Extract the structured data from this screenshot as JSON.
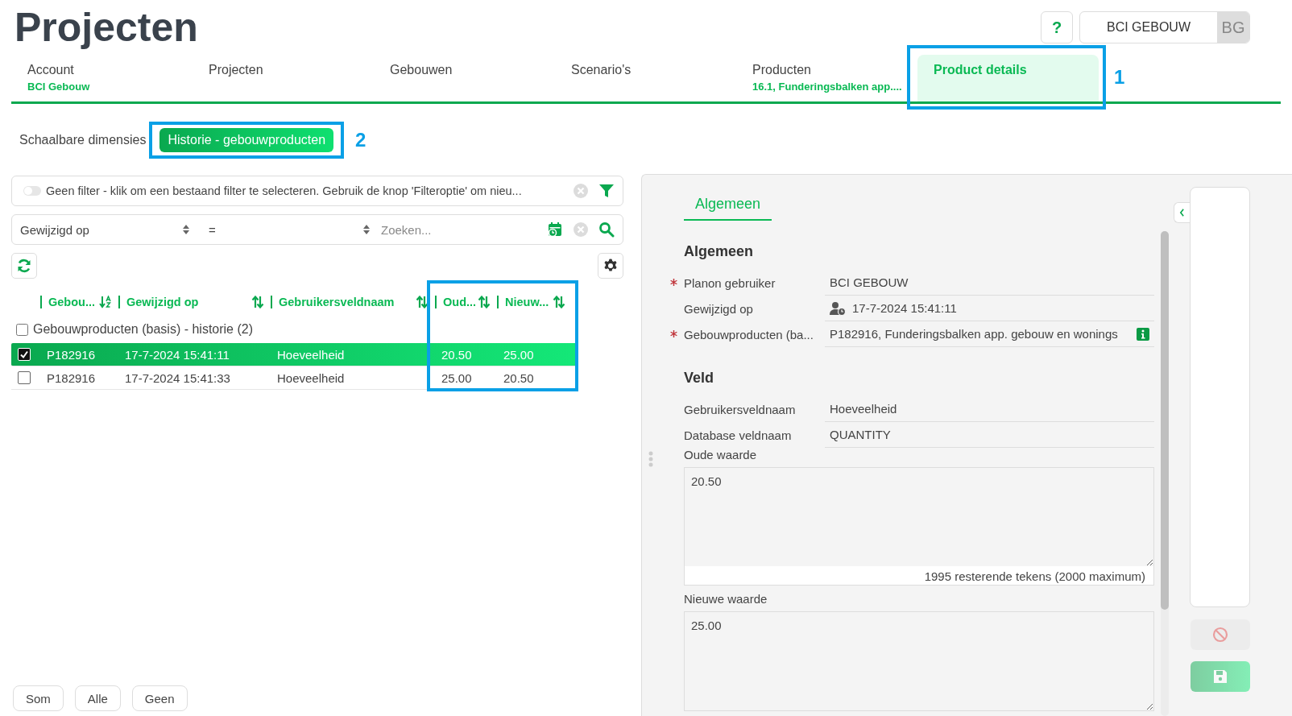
{
  "page_title": "Projecten",
  "header": {
    "help_label": "?",
    "user_name": "BCI GEBOUW",
    "user_initials": "BG"
  },
  "tabs": [
    {
      "label": "Account",
      "sublabel": "BCI Gebouw",
      "selected": false
    },
    {
      "label": "Projecten",
      "selected": false
    },
    {
      "label": "Gebouwen",
      "selected": false
    },
    {
      "label": "Scenario's",
      "selected": false
    },
    {
      "label": "Producten",
      "sublabel": "16.1, Funderingsbalken app....",
      "selected": false
    },
    {
      "label": "Product details",
      "selected": true,
      "callout": "1"
    }
  ],
  "subtabs": [
    {
      "label": "Schaalbare dimensies",
      "selected": false
    },
    {
      "label": "Historie - gebouwproducten",
      "selected": true,
      "callout": "2"
    }
  ],
  "filter": {
    "on": false,
    "text": "Geen filter - klik om een bestaand filter te selecteren. Gebruik de knop 'Filteroptie' om nieu..."
  },
  "search": {
    "field": "Gewijzigd op",
    "operator": "=",
    "placeholder": "Zoeken..."
  },
  "table": {
    "columns": [
      {
        "label": "Gebou...",
        "sorted": true,
        "highlighted": false
      },
      {
        "label": "Gewijzigd op",
        "sorted": false,
        "highlighted": false
      },
      {
        "label": "Gebruikersveldnaam",
        "sorted": false,
        "highlighted": false
      },
      {
        "label": "Oud...",
        "sorted": false,
        "highlighted": true
      },
      {
        "label": "Nieuw...",
        "sorted": false,
        "highlighted": true
      }
    ],
    "group": {
      "label": "Gebouwproducten (basis) - historie (2)",
      "checked": false
    },
    "rows": [
      {
        "checked": true,
        "selected": true,
        "cells": [
          "P182916",
          "17-7-2024 15:41:11",
          "Hoeveelheid",
          "20.50",
          "25.00"
        ]
      },
      {
        "checked": false,
        "selected": false,
        "cells": [
          "P182916",
          "17-7-2024 15:41:33",
          "Hoeveelheid",
          "25.00",
          "20.50"
        ]
      }
    ]
  },
  "footer_buttons": [
    "Som",
    "Alle",
    "Geen"
  ],
  "detail": {
    "tabs": [
      {
        "label": "Algemeen",
        "selected": true
      }
    ],
    "sections": [
      {
        "title": "Algemeen",
        "fields": [
          {
            "kind": "text",
            "label": "Planon gebruiker",
            "value": "BCI GEBOUW",
            "required": true
          },
          {
            "kind": "user-time",
            "label": "Gewijzigd op",
            "value": "17-7-2024 15:41:11",
            "required": false
          },
          {
            "kind": "lookup",
            "label": "Gebouwproducten (ba...",
            "value": "P182916, Funderingsbalken app. gebouw en wonings",
            "required": true
          }
        ]
      },
      {
        "title": "Veld",
        "fields": [
          {
            "kind": "text",
            "label": "Gebruikersveldnaam",
            "value": "Hoeveelheid",
            "required": false
          },
          {
            "kind": "text",
            "label": "Database veldnaam",
            "value": "QUANTITY",
            "required": false
          },
          {
            "kind": "textarea",
            "label": "Oude waarde",
            "value": "20.50",
            "counter": "1995 resterende tekens (2000 maximum)",
            "required": false
          },
          {
            "kind": "textarea",
            "label": "Nieuwe waarde",
            "value": "25.00",
            "required": false
          }
        ]
      }
    ]
  },
  "actions": [
    {
      "kind": "cancel",
      "disabled": true
    },
    {
      "kind": "save",
      "disabled": true
    }
  ]
}
